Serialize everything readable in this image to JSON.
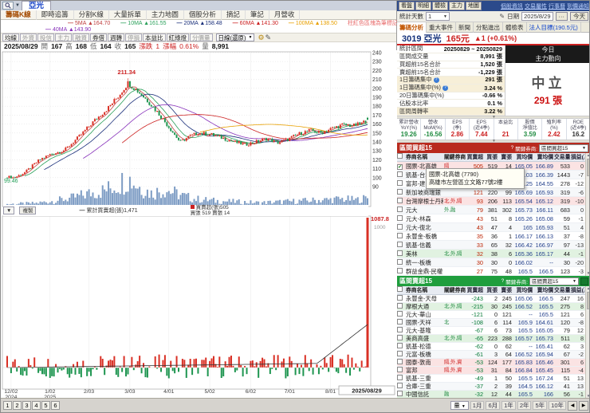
{
  "window": {
    "title": "亞光"
  },
  "menu_tabs": [
    {
      "label": "籌碼K線",
      "active": true
    },
    {
      "label": "即時追籌"
    },
    {
      "label": "分割K線"
    },
    {
      "label": "大量拆單"
    },
    {
      "label": "主力地圖"
    },
    {
      "label": "個股分析"
    },
    {
      "label": "摘記"
    },
    {
      "label": "筆記"
    },
    {
      "label": "月營收"
    }
  ],
  "ma_legend": {
    "row1": [
      {
        "name": "5MA",
        "value": "▲164.70",
        "color": "#c04040"
      },
      {
        "name": "10MA",
        "value": "▲161.55",
        "color": "#2aa05a"
      },
      {
        "name": "20MA",
        "value": "▲158.48",
        "color": "#1a2f7a"
      },
      {
        "name": "60MA",
        "value": "▲141.30",
        "color": "#cc2020"
      },
      {
        "name": "100MA",
        "value": "▲138.50",
        "color": "#e8a000"
      }
    ],
    "row2": [
      {
        "name": "40MA",
        "value": "▲143.90",
        "color": "#8833bb"
      }
    ],
    "note": "柱紅色區塊為筆標記"
  },
  "chart_toolbar": {
    "buttons": [
      {
        "label": "均線"
      },
      {
        "label": "外資",
        "muted": true
      },
      {
        "label": "投信",
        "muted": true
      },
      {
        "label": "主力",
        "muted": true
      },
      {
        "label": "融資",
        "muted": true
      },
      {
        "label": "券借"
      },
      {
        "label": "週轉"
      },
      {
        "label": "停損",
        "muted": true
      },
      {
        "label": "本益比"
      },
      {
        "label": "紅綠燈"
      },
      {
        "label": "分價量",
        "muted": true
      }
    ],
    "period_select": "日線(還原)"
  },
  "ohlc_bar": {
    "date": "2025/08/29",
    "o_label": "開",
    "o": "167",
    "h_label": "高",
    "h": "168",
    "l_label": "低",
    "l": "164",
    "c_label": "收",
    "c": "165",
    "chg_label": "漲跌",
    "chg": "1",
    "pct_label": "漲幅",
    "pct": "0.61%",
    "vol_label": "量",
    "vol": "8,991"
  },
  "chart_data": {
    "type": "candlestick",
    "symbol": "3019 亞光",
    "y_ticks": [
      240,
      230,
      220,
      210,
      200,
      190,
      180,
      170,
      160,
      150,
      140,
      130,
      120,
      110,
      100,
      90
    ],
    "x_ticks": [
      "12/02",
      "1/02",
      "2/03",
      "3/03",
      "4/01",
      "5/02",
      "6/02",
      "7/01",
      "8/01"
    ],
    "x_years": [
      "2024",
      "2025"
    ],
    "x_last": "2025/08/29",
    "high_marker": "211.34",
    "low_marker": "99.46",
    "ma_values": {
      "5MA": 164.7,
      "10MA": 161.55,
      "20MA": 158.48,
      "40MA": 143.9,
      "60MA": 141.3,
      "100MA": 138.5
    },
    "last_bar": {
      "open": 167,
      "high": 168,
      "low": 164,
      "close": 165,
      "volume": 8991
    },
    "price_anchors": [
      [
        0,
        101
      ],
      [
        0.02,
        100
      ],
      [
        0.05,
        106
      ],
      [
        0.09,
        120
      ],
      [
        0.12,
        126
      ],
      [
        0.16,
        131
      ],
      [
        0.2,
        146
      ],
      [
        0.24,
        163
      ],
      [
        0.28,
        178
      ],
      [
        0.31,
        192
      ],
      [
        0.335,
        206
      ],
      [
        0.36,
        198
      ],
      [
        0.39,
        186
      ],
      [
        0.42,
        172
      ],
      [
        0.45,
        156
      ],
      [
        0.48,
        140
      ],
      [
        0.505,
        146
      ],
      [
        0.53,
        150
      ],
      [
        0.57,
        148
      ],
      [
        0.6,
        144
      ],
      [
        0.63,
        140
      ],
      [
        0.66,
        137
      ],
      [
        0.69,
        140
      ],
      [
        0.72,
        144
      ],
      [
        0.75,
        139
      ],
      [
        0.78,
        143
      ],
      [
        0.81,
        149
      ],
      [
        0.84,
        153
      ],
      [
        0.87,
        150
      ],
      [
        0.9,
        155
      ],
      [
        0.93,
        159
      ],
      [
        0.96,
        158
      ],
      [
        0.985,
        161
      ],
      [
        1,
        165
      ]
    ],
    "volume_anchors": [
      [
        0,
        2.5
      ],
      [
        0.08,
        3.5
      ],
      [
        0.13,
        6
      ],
      [
        0.18,
        9
      ],
      [
        0.23,
        14
      ],
      [
        0.27,
        17
      ],
      [
        0.3,
        22
      ],
      [
        0.335,
        30
      ],
      [
        0.37,
        20
      ],
      [
        0.4,
        14
      ],
      [
        0.44,
        18
      ],
      [
        0.48,
        12
      ],
      [
        0.52,
        8
      ],
      [
        0.58,
        6
      ],
      [
        0.64,
        5
      ],
      [
        0.7,
        4
      ],
      [
        0.76,
        5
      ],
      [
        0.82,
        6
      ],
      [
        0.88,
        7
      ],
      [
        0.93,
        8
      ],
      [
        0.97,
        7
      ],
      [
        1,
        9
      ]
    ],
    "pane2": {
      "controls_copy": "複製",
      "cum_legend": "累計買賣超(張)1,471",
      "bar_legend": "買賣超(張)505",
      "buy_legend": "買張 519",
      "sell_legend": "賣張 14",
      "axis_label": "1087.8",
      "axis_tick": "1000",
      "last_bar": 505,
      "cumulative": 1471
    }
  },
  "right_panel": {
    "topbar": {
      "buttons": [
        "看盤",
        "明細",
        "體檢",
        "主力",
        "地圖"
      ],
      "links": [
        "個股資訊",
        "交易屬性",
        "行事曆",
        "到價通知"
      ]
    },
    "control_row": {
      "days_label": "統計天數",
      "days": "1",
      "date_label": "日期",
      "date": "2025/8/29",
      "more": "···",
      "today": "今天"
    },
    "tabs": [
      {
        "label": "籌碼分析",
        "active": true
      },
      {
        "label": "重大事件"
      },
      {
        "label": "新聞"
      },
      {
        "label": "分點進出"
      },
      {
        "label": "體檢表"
      },
      {
        "label": "法人目標(190.5元)",
        "link": true
      }
    ],
    "stock": {
      "id_name": "3019 亞光",
      "price": "165元",
      "change": "▲1 (+0.61%)"
    },
    "stats_rows": [
      {
        "label": "統計區間",
        "value": "20250829 ~ 20250829"
      },
      {
        "label": "區間成交量",
        "value": "8,991 張"
      },
      {
        "label": "買超前15名合計",
        "value": "1,520 張"
      },
      {
        "label": "賣超前15名合計",
        "value": "-1,229 張"
      },
      {
        "label": "1日籌碼集中",
        "value": "291 張",
        "q": true,
        "hl": true
      },
      {
        "label": "1日籌碼集中(%)",
        "value": "3.24 %",
        "q": true,
        "hl": true
      },
      {
        "label": "20日籌碼集中(%)",
        "value": "-0.66 %"
      },
      {
        "label": "佔股本比率",
        "value": "0.1 %"
      },
      {
        "label": "區間周轉率",
        "value": "3.22 %",
        "hl": true
      }
    ],
    "trend_box": {
      "line1": "今日",
      "line2": "主力動向",
      "state": "中立",
      "value": "291 張"
    },
    "financial": [
      {
        "l1": "累計營收",
        "l2": "YoY(%)",
        "v": "19.26",
        "c": "#1f8a3f"
      },
      {
        "l1": "營收",
        "l2": "MoM(%)",
        "v": "-16.56",
        "c": "#1f8a3f"
      },
      {
        "l1": "EPS",
        "l2": "(季)",
        "v": "2.86",
        "c": "#cc2222"
      },
      {
        "l1": "EPS",
        "l2": "(近4季)",
        "v": "7.44",
        "c": "#cc2222"
      },
      {
        "l1": "本益比",
        "l2": "",
        "v": "21",
        "c": "#cc2222"
      },
      {
        "l1": "股價",
        "l2": "淨值比",
        "v": "3.59",
        "c": "#1f8a3f"
      },
      {
        "l1": "殖利率",
        "l2": "(%)",
        "v": "2.42",
        "c": "#cc2222"
      },
      {
        "l1": "ROE",
        "l2": "(近4季)",
        "v": "16.2",
        "c": "#333333"
      }
    ],
    "buy_section": {
      "title": "區間買超15",
      "q": "?",
      "key_label": "關鍵券商:",
      "select": "區間買超15"
    },
    "sell_section": {
      "title": "區間賣超15",
      "q": "?",
      "key_label": "關鍵券商:",
      "select": "區間賣超15"
    },
    "table_headers": [
      "券商名稱",
      "關鍵券商",
      "買賣超",
      "買張",
      "賣張",
      "買均價",
      "賣均價",
      "交易量",
      "損益(萬)"
    ],
    "buy_rows": [
      {
        "name": "國票-北高雄",
        "key": "隔",
        "kc": "r",
        "net": "505",
        "b": "519",
        "s": "14",
        "ba": "165.05",
        "sa": "166.89",
        "v": "533",
        "pl": "0",
        "tint": "pink",
        "checked": true
      },
      {
        "name": "凱基-台北",
        "key": "",
        "net": "271",
        "b": "857",
        "s": "586",
        "ba": "166.03",
        "sa": "166.39",
        "v": "1443",
        "pl": "-7"
      },
      {
        "name": "富邦-建國",
        "key": "",
        "net": "162",
        "b": "220",
        "s": "58",
        "ba": "166.25",
        "sa": "164.55",
        "v": "278",
        "pl": "-12"
      },
      {
        "name": "新加坡商瑞銀",
        "key": "",
        "net": "121",
        "b": "220",
        "s": "99",
        "ba": "165.69",
        "sa": "165.93",
        "v": "319",
        "pl": "-6"
      },
      {
        "name": "台灣摩根士丹利",
        "key": "北,外,隔",
        "kc": "r",
        "net": "93",
        "b": "206",
        "s": "113",
        "ba": "165.54",
        "sa": "165.12",
        "v": "319",
        "pl": "-10",
        "tint": "pink"
      },
      {
        "name": "元大",
        "key": "外,融",
        "kc": "g",
        "net": "79",
        "b": "381",
        "s": "302",
        "ba": "165.73",
        "sa": "166.11",
        "v": "683",
        "pl": "0"
      },
      {
        "name": "元大-林森",
        "key": "",
        "net": "43",
        "b": "51",
        "s": "8",
        "ba": "165.26",
        "sa": "165.08",
        "v": "59",
        "pl": "-1"
      },
      {
        "name": "元大-復北",
        "key": "",
        "net": "43",
        "b": "47",
        "s": "4",
        "ba": "165",
        "sa": "165.93",
        "v": "51",
        "pl": "4"
      },
      {
        "name": "永豐金-板橋",
        "key": "",
        "net": "35",
        "b": "36",
        "s": "1",
        "ba": "166.17",
        "sa": "166.13",
        "v": "37",
        "pl": "-8"
      },
      {
        "name": "凱基-信義",
        "key": "",
        "net": "33",
        "b": "65",
        "s": "32",
        "ba": "166.42",
        "sa": "166.97",
        "v": "97",
        "pl": "-13"
      },
      {
        "name": "美林",
        "key": "北,外,隔",
        "kc": "g",
        "net": "32",
        "b": "38",
        "s": "6",
        "ba": "165.36",
        "sa": "165.17",
        "v": "44",
        "pl": "-1",
        "tint": "green"
      },
      {
        "name": "統一-板橋",
        "key": "",
        "net": "30",
        "b": "30",
        "s": "0",
        "ba": "166.02",
        "sa": "--",
        "v": "30",
        "pl": "-20"
      },
      {
        "name": "群益金鼎-民權",
        "key": "",
        "net": "27",
        "b": "75",
        "s": "48",
        "ba": "165.5",
        "sa": "166.5",
        "v": "123",
        "pl": "-3"
      }
    ],
    "sell_rows": [
      {
        "name": "永豐金-天母",
        "key": "",
        "net": "-243",
        "b": "2",
        "s": "245",
        "ba": "165.06",
        "sa": "166.5",
        "v": "247",
        "pl": "16"
      },
      {
        "name": "摩根大通",
        "key": "北,外,隔",
        "kc": "g",
        "net": "-215",
        "b": "30",
        "s": "245",
        "ba": "166.52",
        "sa": "165.5",
        "v": "275",
        "pl": "8",
        "tint": "green"
      },
      {
        "name": "元大-華山",
        "key": "",
        "net": "-121",
        "b": "0",
        "s": "121",
        "ba": "--",
        "sa": "165.5",
        "v": "121",
        "pl": "6"
      },
      {
        "name": "國票-天祥",
        "key": "北",
        "kc": "g",
        "net": "-108",
        "b": "6",
        "s": "114",
        "ba": "165.9",
        "sa": "164.61",
        "v": "120",
        "pl": "-8"
      },
      {
        "name": "元大-基隆",
        "key": "",
        "net": "-67",
        "b": "6",
        "s": "73",
        "ba": "165.5",
        "sa": "165.05",
        "v": "79",
        "pl": "12"
      },
      {
        "name": "美商高盛",
        "key": "北,外,隔",
        "kc": "g",
        "net": "-65",
        "b": "223",
        "s": "288",
        "ba": "165.57",
        "sa": "165.73",
        "v": "511",
        "pl": "8",
        "tint": "green"
      },
      {
        "name": "凱基-松德",
        "key": "",
        "net": "-62",
        "b": "0",
        "s": "62",
        "ba": "--",
        "sa": "165.41",
        "v": "62",
        "pl": "3"
      },
      {
        "name": "元富-板橋",
        "key": "",
        "net": "-61",
        "b": "3",
        "s": "64",
        "ba": "166.52",
        "sa": "165.94",
        "v": "67",
        "pl": "-2"
      },
      {
        "name": "國泰-敦南",
        "key": "隔,外,資",
        "kc": "r",
        "net": "-53",
        "b": "124",
        "s": "177",
        "ba": "165.83",
        "sa": "165.46",
        "v": "301",
        "pl": "6",
        "tint": "pink"
      },
      {
        "name": "富邦",
        "key": "隔,外,資",
        "kc": "r",
        "net": "-53",
        "b": "31",
        "s": "84",
        "ba": "166.84",
        "sa": "165.45",
        "v": "115",
        "pl": "-4",
        "tint": "pink"
      },
      {
        "name": "凱基-三重",
        "key": "",
        "net": "-49",
        "b": "1",
        "s": "50",
        "ba": "165.5",
        "sa": "167.24",
        "v": "51",
        "pl": "13"
      },
      {
        "name": "合庫-三重",
        "key": "",
        "net": "-37",
        "b": "2",
        "s": "39",
        "ba": "164.5",
        "sa": "166.12",
        "v": "41",
        "pl": "13"
      },
      {
        "name": "中國信託",
        "key": "融",
        "kc": "g",
        "net": "-32",
        "b": "12",
        "s": "44",
        "ba": "165.5",
        "sa": "166",
        "v": "56",
        "pl": "-1",
        "tint": "green"
      }
    ],
    "tooltip": {
      "line1": "國票-北高雄 (7790)",
      "line2": "高雄市左營區立文路77號2樓"
    }
  },
  "statusbar": {
    "pages": [
      "1",
      "2",
      "3",
      "4",
      "5",
      "6"
    ],
    "select": "量",
    "periods": [
      "1月",
      "6月",
      "1年",
      "2年",
      "5年",
      "10年"
    ],
    "prev": "◀",
    "next": "▶"
  }
}
